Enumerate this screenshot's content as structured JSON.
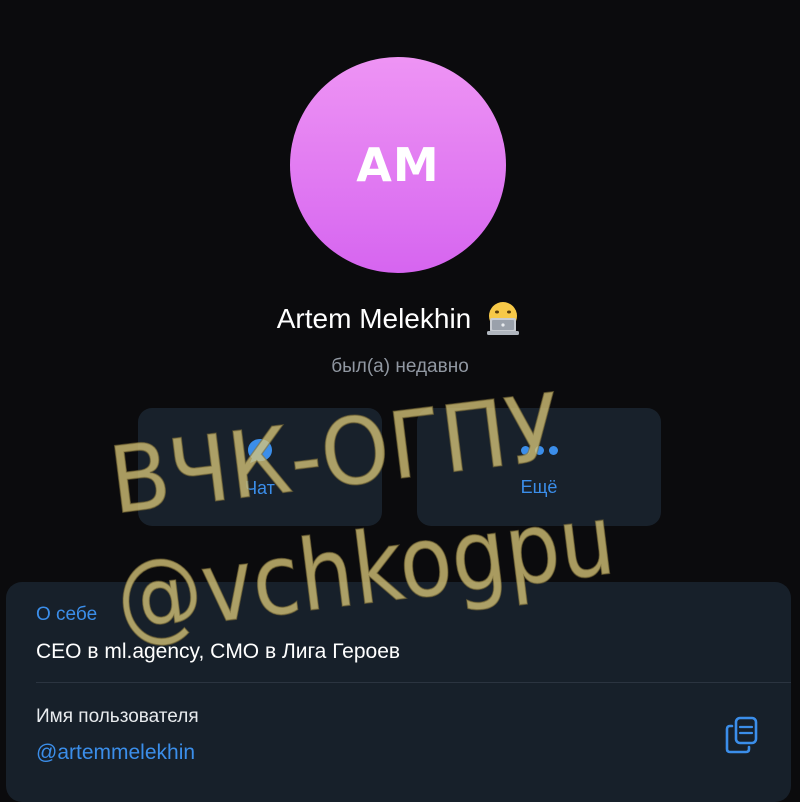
{
  "profile": {
    "initials": "AM",
    "name": "Artem Melekhin",
    "status_emoji_icon": "face-with-laptop-emoji-icon",
    "status": "был(а) недавно",
    "avatar_colors": [
      "#ee94f4",
      "#d665f0"
    ]
  },
  "actions": {
    "chat": {
      "label": "Чат",
      "icon": "chat-bubble-icon"
    },
    "more": {
      "label": "Ещё",
      "icon": "more-dots-icon"
    }
  },
  "info": {
    "about_label": "О себе",
    "about_text": "CEO в ml.agency, CMO в Лига Героев",
    "username_label": "Имя пользователя",
    "username": "@artemmelekhin",
    "copy_icon": "copy-icon"
  },
  "watermark": {
    "line1": "ВЧК-ОГПУ",
    "line2": "@vchkogpu"
  },
  "colors": {
    "background": "#0b0b0d",
    "card": "#17202a",
    "accent": "#3b8eea",
    "muted": "#9198a2"
  }
}
